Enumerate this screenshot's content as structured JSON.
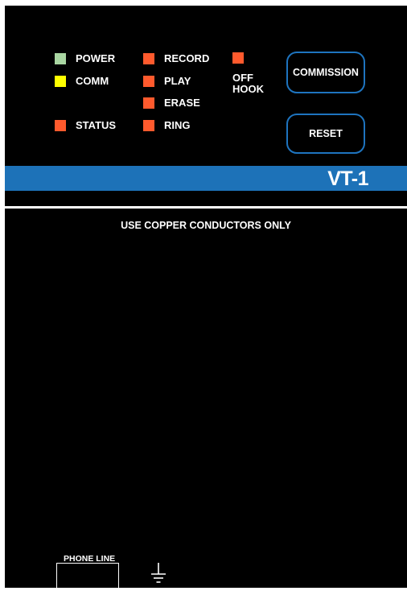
{
  "leds": [
    {
      "id": "power",
      "label": "POWER",
      "color": "#a9d6a2"
    },
    {
      "id": "comm",
      "label": "COMM",
      "color": "#ffff00"
    },
    {
      "id": "status",
      "label": "STATUS",
      "color": "#ff5a2d"
    },
    {
      "id": "record",
      "label": "RECORD",
      "color": "#ff5a2d"
    },
    {
      "id": "play",
      "label": "PLAY",
      "color": "#ff5a2d"
    },
    {
      "id": "erase",
      "label": "ERASE",
      "color": "#ff5a2d"
    },
    {
      "id": "ring",
      "label": "RING",
      "color": "#ff5a2d"
    },
    {
      "id": "off_hook",
      "label_line1": "OFF",
      "label_line2": "HOOK",
      "color": "#ff5a2d"
    }
  ],
  "buttons": {
    "commission": "COMMISSION",
    "reset": "RESET"
  },
  "model_label": "VT-1",
  "notice": "USE COPPER CONDUCTORS ONLY",
  "phone_line_label": "PHONE LINE",
  "icons": {
    "ground": "ground-icon"
  },
  "colors": {
    "panel": "#000000",
    "brand_bar": "#1d72b8",
    "button_border": "#1e74bf"
  }
}
